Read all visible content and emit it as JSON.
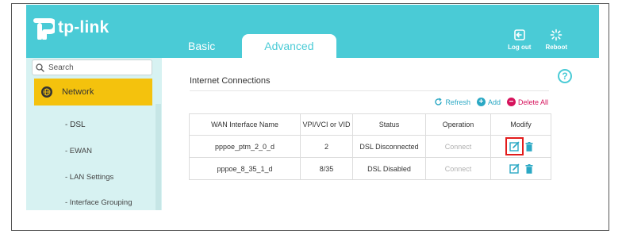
{
  "brand": {
    "name": "tp-link",
    "color": "#4acbd6"
  },
  "tabs": [
    {
      "label": "Basic",
      "active": false
    },
    {
      "label": "Advanced",
      "active": true
    }
  ],
  "top_actions": {
    "logout_label": "Log out",
    "reboot_label": "Reboot"
  },
  "sidebar": {
    "search_placeholder": "Search",
    "network_label": "Network",
    "items": [
      {
        "label": "- DSL",
        "active": true
      },
      {
        "label": "- EWAN",
        "active": false
      },
      {
        "label": "- LAN Settings",
        "active": false
      },
      {
        "label": "- Interface Grouping",
        "active": false
      }
    ]
  },
  "main": {
    "section_title": "Internet Connections",
    "help_symbol": "?",
    "actions": {
      "refresh": "Refresh",
      "add": "Add",
      "delete_all": "Delete All"
    },
    "table": {
      "headers": [
        "WAN Interface Name",
        "VPI/VCI or VID",
        "Status",
        "Operation",
        "Modify"
      ],
      "rows": [
        {
          "name": "pppoe_ptm_2_0_d",
          "vpi": "2",
          "status": "DSL Disconnected",
          "operation": "Connect",
          "edit_highlighted": true
        },
        {
          "name": "pppoe_8_35_1_d",
          "vpi": "8/35",
          "status": "DSL Disabled",
          "operation": "Connect",
          "edit_highlighted": false
        }
      ]
    }
  },
  "colors": {
    "accent": "#4acbd6",
    "nav_active": "#f4c20d",
    "delete": "#d6135c",
    "highlight": "#e21b1b"
  }
}
